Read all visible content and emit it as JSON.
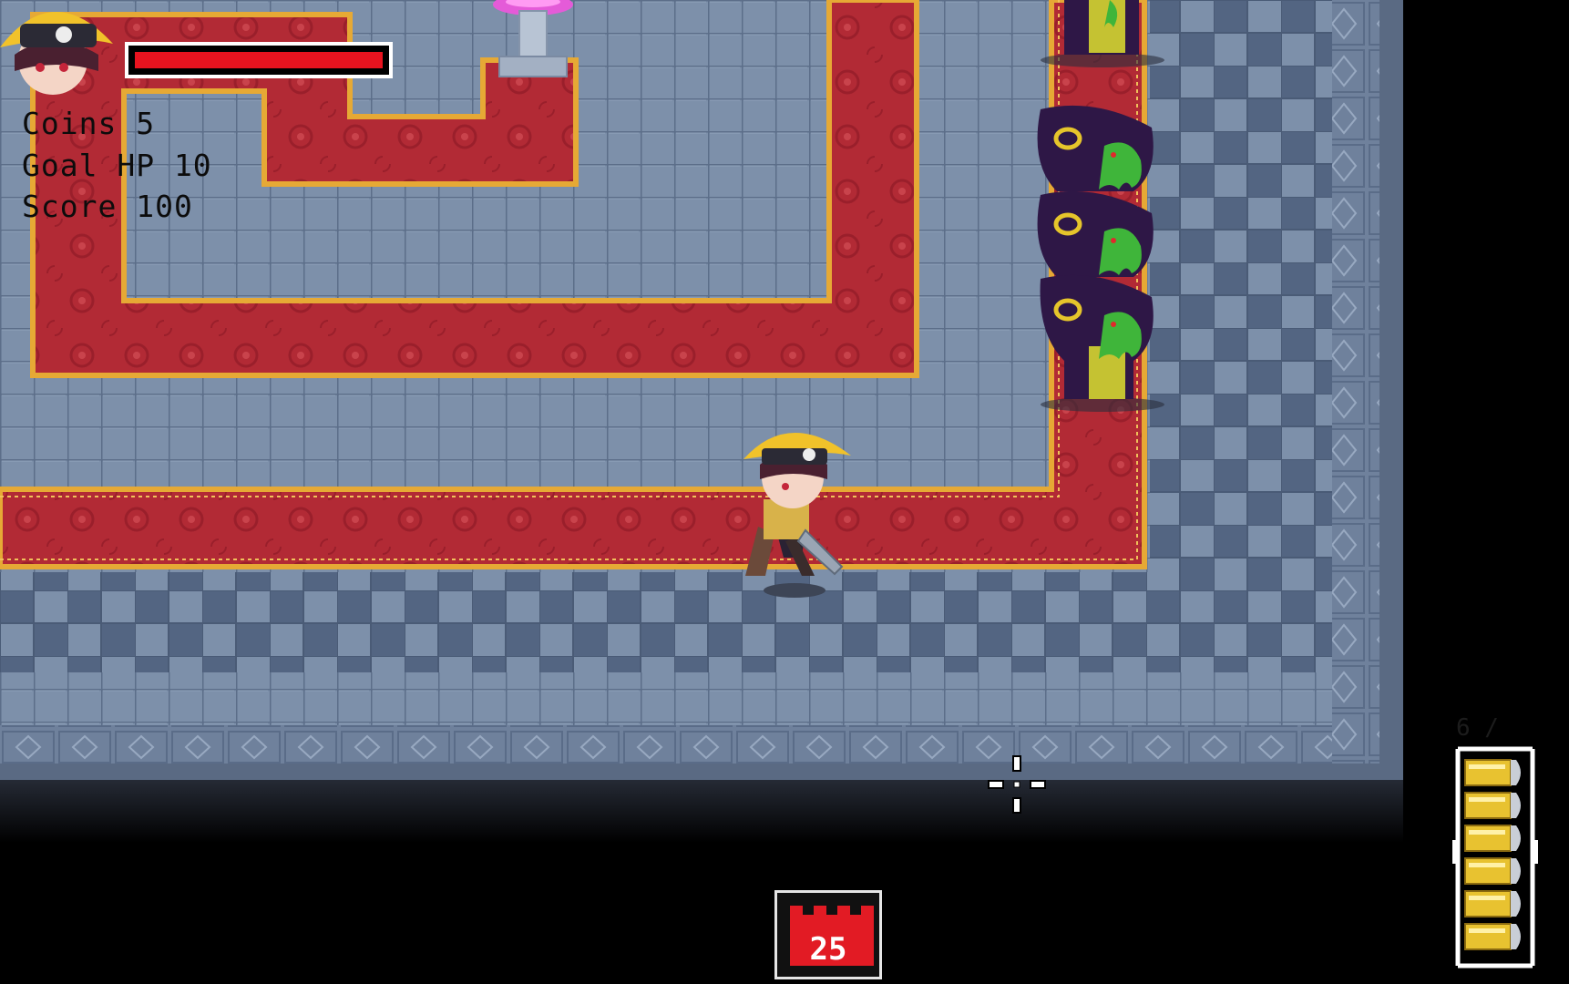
{
  "hud": {
    "coins_label": "Coins 5",
    "goal_hp_label": "Goal HP 10",
    "score_label": "Score 100",
    "player_hp_fraction": 1.0,
    "hp_color": "#e8131f"
  },
  "ammo": {
    "count_label": "6 /",
    "bullets_loaded": 6,
    "bullet_color": "#e8c230"
  },
  "wave": {
    "number": "25",
    "icon": "castle-tower-icon",
    "icon_color": "#e21b24"
  },
  "palette": {
    "floor": "#7d90aa",
    "floor_grid": "#5c6e89",
    "carpet": "#b22a35",
    "carpet_border": "#e6a935",
    "void": "#000000",
    "enemy_robe": "#2e1746",
    "enemy_slime": "#3fb53a",
    "player_hat": "#f1c22a"
  },
  "entities": {
    "player": "pirate-girl-player",
    "enemies": [
      "hooded-slime-enemy",
      "hooded-slime-enemy",
      "hooded-slime-enemy",
      "hooded-slime-enemy"
    ],
    "pedestal": "crystal-pedestal"
  }
}
